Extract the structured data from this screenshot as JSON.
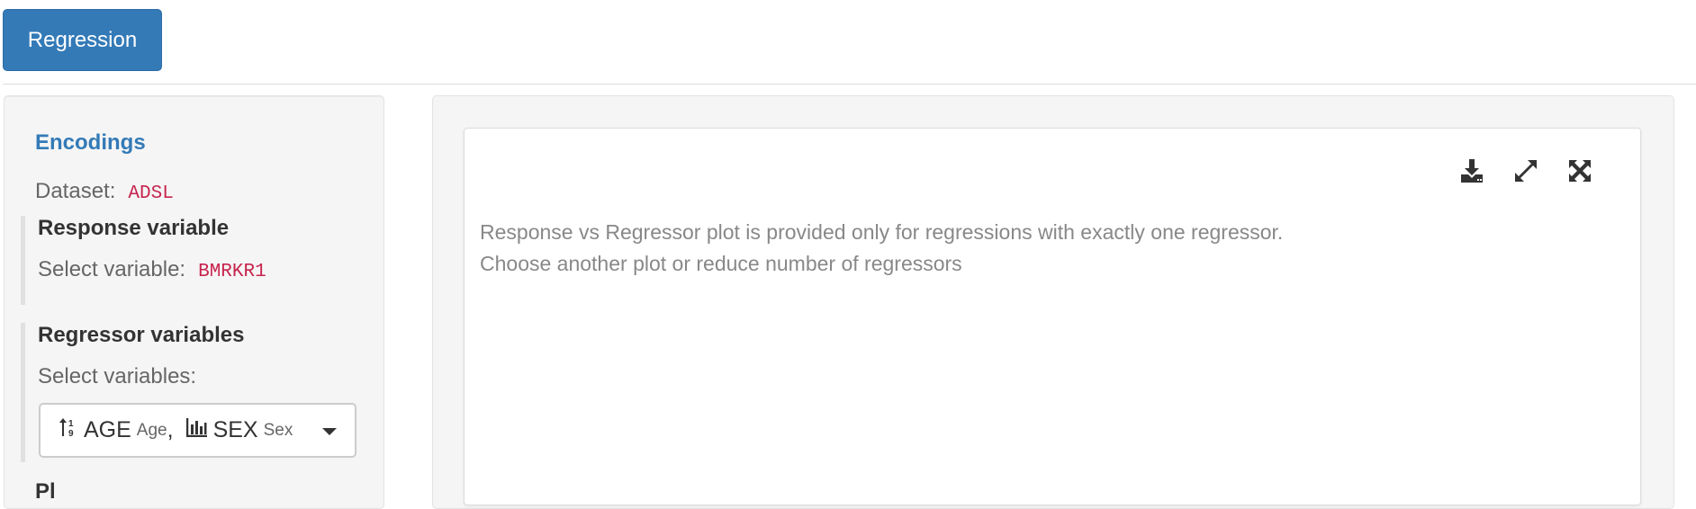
{
  "tabs": {
    "active_label": "Regression"
  },
  "sidebar": {
    "title": "Encodings",
    "dataset_label": "Dataset:",
    "dataset_value": "ADSL",
    "response": {
      "title": "Response variable",
      "select_label": "Select variable:",
      "value": "BMRKR1"
    },
    "regressor": {
      "title": "Regressor variables",
      "select_label": "Select variables:",
      "items": [
        {
          "name": "AGE",
          "label": "Age",
          "icon": "numeric-icon"
        },
        {
          "name": "SEX",
          "label": "Sex",
          "icon": "bar-chart-icon"
        }
      ],
      "separator": ","
    },
    "next_section_partial": "Pl"
  },
  "plot": {
    "message_line1": "Response vs Regressor plot is provided only for regressions with exactly one regressor.",
    "message_line2": "Choose another plot or reduce number of regressors",
    "toolbar": [
      "download-icon",
      "expand-icon",
      "fullscreen-icon"
    ]
  },
  "colors": {
    "accent": "#337ab7",
    "code": "#c7254e",
    "panel_bg": "#f5f5f5"
  }
}
